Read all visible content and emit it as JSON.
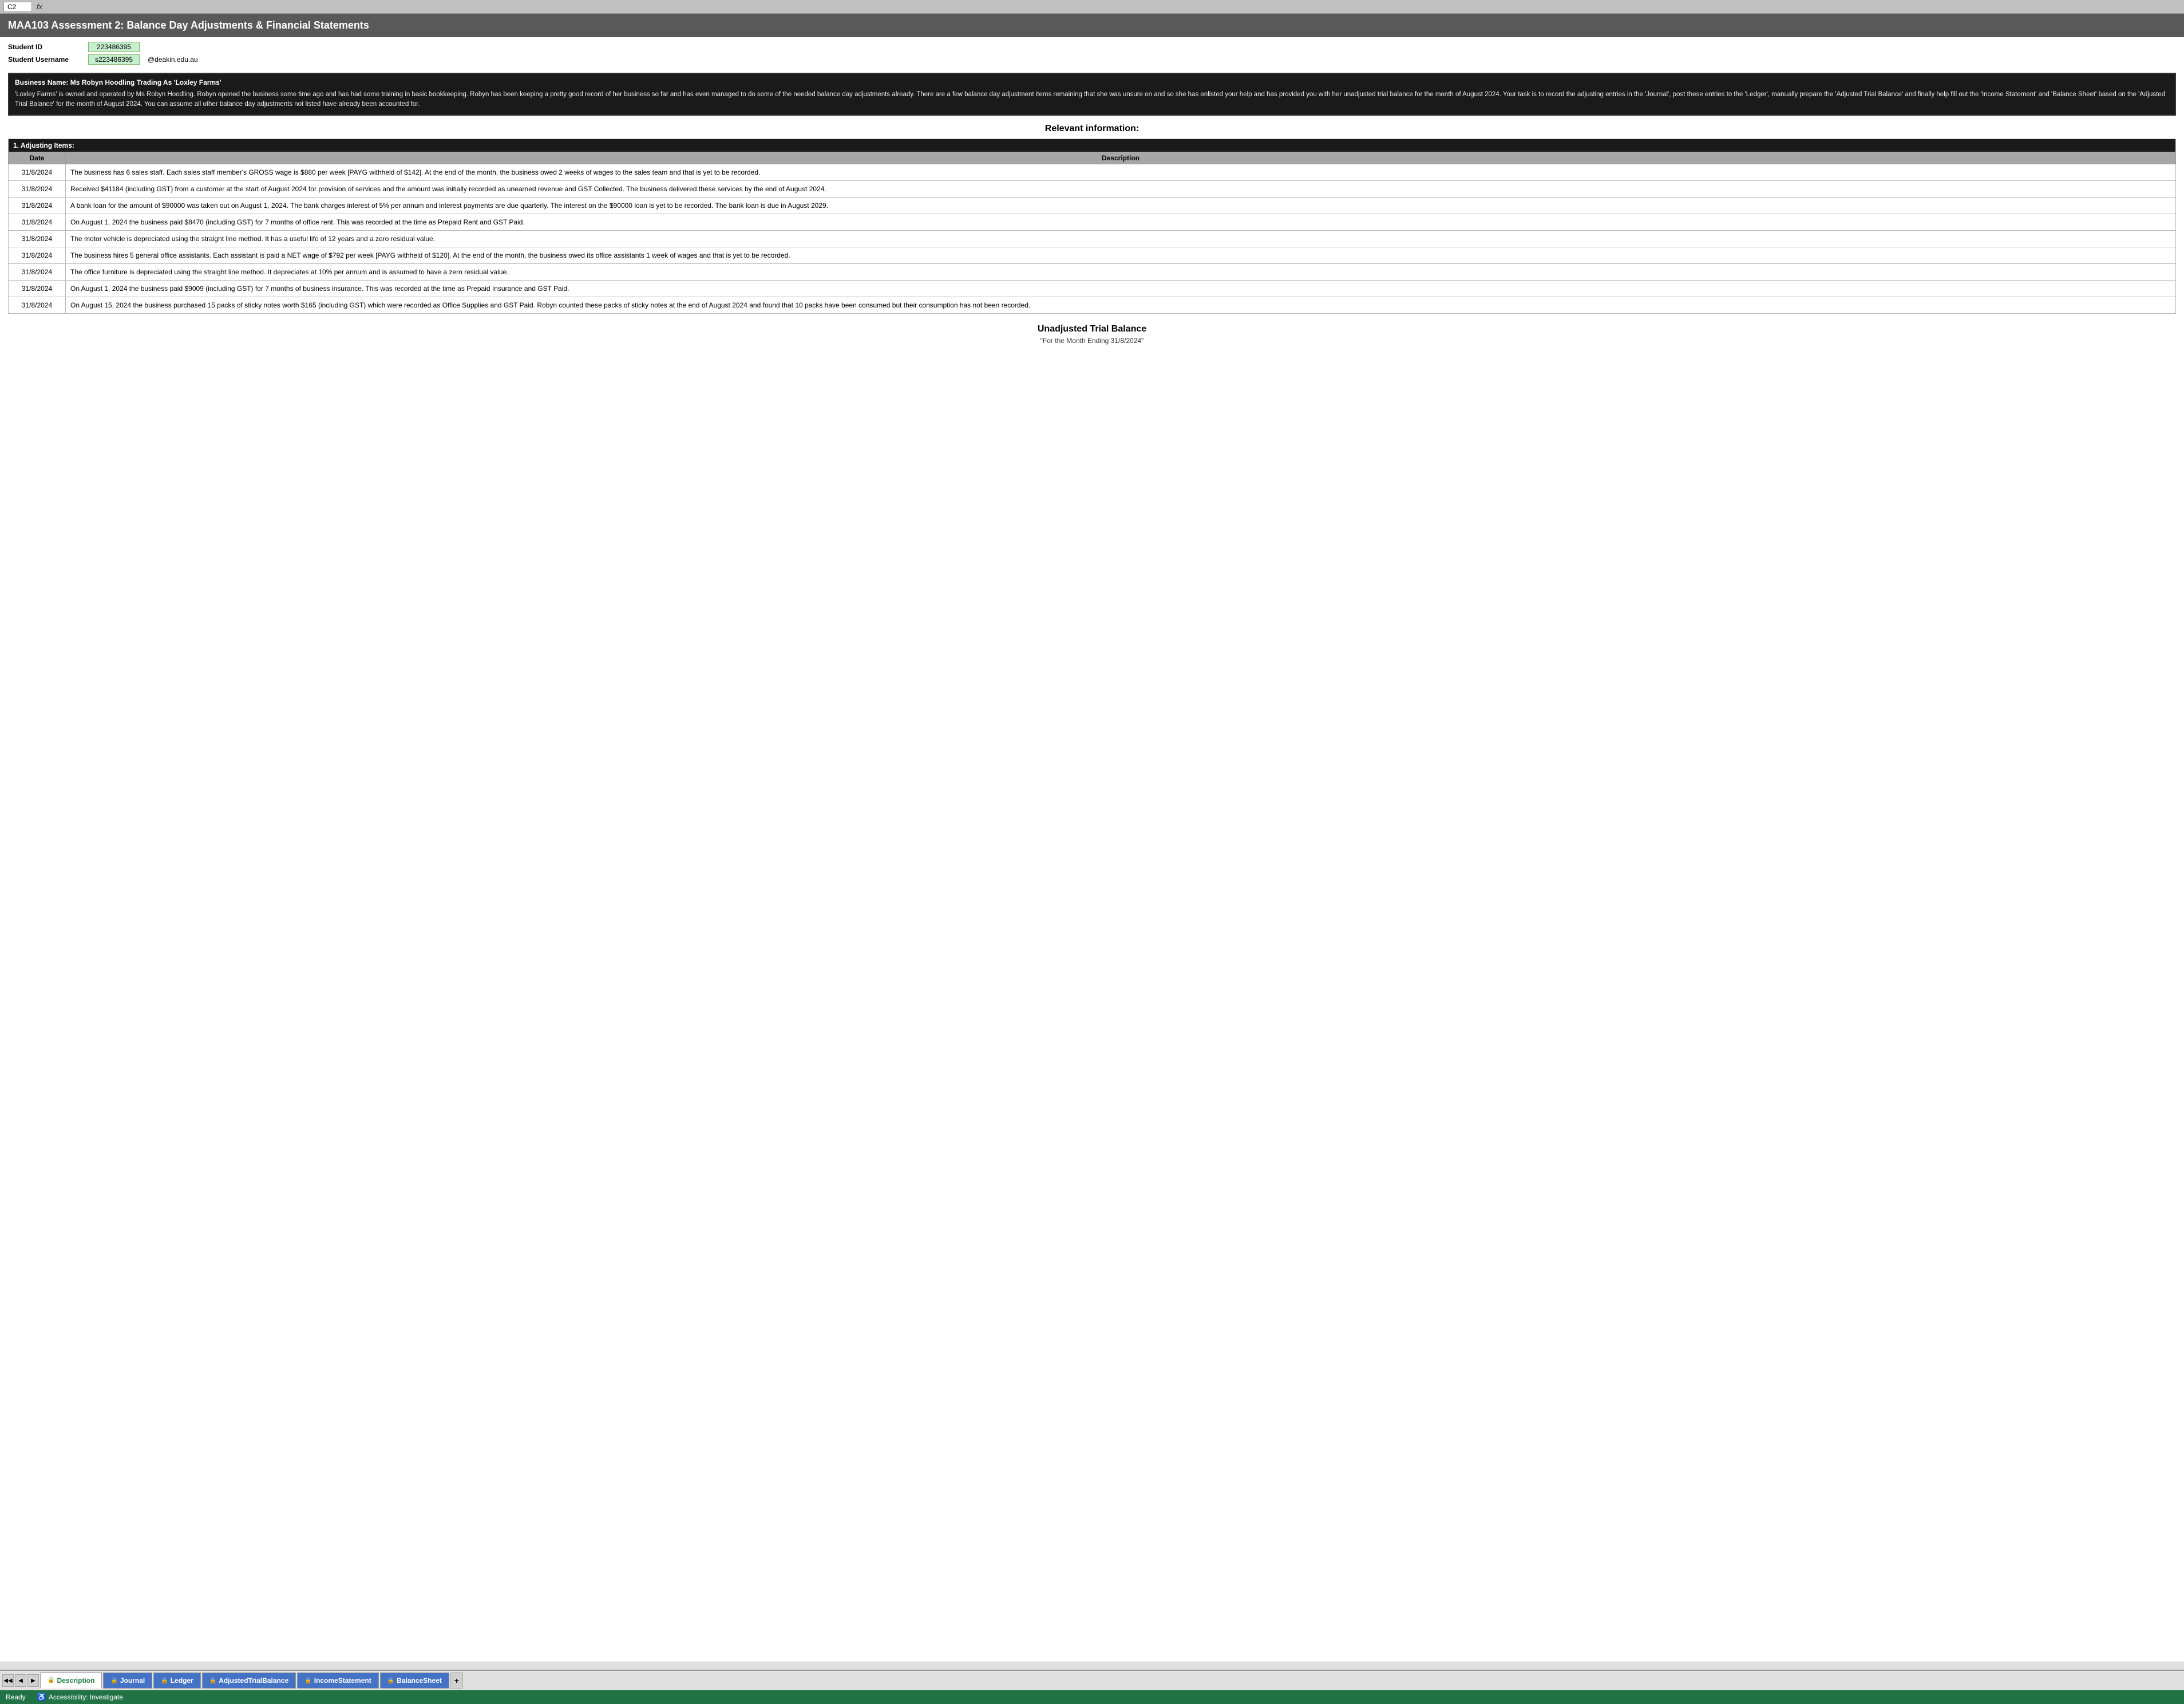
{
  "formula_bar": {
    "cell_ref": "C2",
    "fx": "fx"
  },
  "page_title": "MAA103 Assessment 2: Balance Day Adjustments & Financial Statements",
  "student": {
    "id_label": "Student ID",
    "id_value": "223486395",
    "username_label": "Student Username",
    "username_value": "s223486395",
    "email": "@deakin.edu.au"
  },
  "business": {
    "title": "Business Name: Ms Robyn Hoodling Trading As 'Loxley Farms'",
    "description": "'Loxley Farms' is owned and operated by Ms Robyn Hoodling. Robyn opened the business some time ago and has had some training in basic bookkeeping. Robyn has been keeping a pretty good record of her business so far and has even managed to do some of the needed balance day adjustments already. There are a few balance day adjustment items remaining that she was unsure on and so she has enlisted your help and has provided you with her unadjusted trial balance for the month of August 2024. Your task is to record the adjusting entries in the 'Journal', post these entries to the 'Ledger', manually prepare the 'Adjusted Trial Balance' and finally help fill out the 'Income Statement' and 'Balance Sheet' based on the 'Adjusted Trial Balance' for the month of August 2024. You can assume all other balance day adjustments not listed have already been accounted for."
  },
  "relevant_info_heading": "Relevant information:",
  "adjusting_items": {
    "section_label": "1. Adjusting Items:",
    "col_date": "Date",
    "col_description": "Description",
    "rows": [
      {
        "date": "31/8/2024",
        "description": "The business has 6 sales staff. Each sales staff member's GROSS wage is $880 per week [PAYG withheld of $142]. At the end of the month, the business owed 2 weeks of wages to the sales team and that is yet to be recorded."
      },
      {
        "date": "31/8/2024",
        "description": "Received $41184 (including GST) from a customer at the start of August 2024 for provision of services and the amount was initially recorded as unearned revenue and GST Collected. The business delivered these services by the end of August 2024."
      },
      {
        "date": "31/8/2024",
        "description": "A bank loan for the amount of $90000 was taken out on August 1, 2024. The bank charges interest of 5% per annum and interest payments are due quarterly. The interest on the $90000 loan is yet to be recorded. The bank loan is due in August 2029."
      },
      {
        "date": "31/8/2024",
        "description": "On August 1, 2024 the business paid $8470 (including GST) for 7 months of office rent. This was recorded at the time as Prepaid Rent and GST Paid."
      },
      {
        "date": "31/8/2024",
        "description": "The motor vehicle is depreciated using the straight line method. It has a useful life of 12 years and a zero residual value."
      },
      {
        "date": "31/8/2024",
        "description": "The business hires 5 general office assistants. Each assistant is paid a NET wage of $792 per week [PAYG withheld of $120]. At the end of the month, the business owed its office assistants 1 week of wages and that is yet to be recorded."
      },
      {
        "date": "31/8/2024",
        "description": "The office furniture is depreciated using the straight line method. It depreciates at 10% per annum and is assumed to have a zero residual value."
      },
      {
        "date": "31/8/2024",
        "description": "On August 1, 2024 the business paid $9009 (including GST) for 7 months of business insurance. This was recorded at the time as Prepaid Insurance and GST Paid."
      },
      {
        "date": "31/8/2024",
        "description": "On August 15, 2024 the business purchased 15 packs of sticky notes worth $165 (including GST) which were recorded as Office Supplies and GST Paid. Robyn counted these packs of sticky notes at the end of August 2024 and found that 10 packs have been consumed but their consumption has not been recorded."
      }
    ]
  },
  "utb_heading": "Unadjusted Trial Balance",
  "utb_subheading": "\"For the Month Ending 31/8/2024\"",
  "tabs": [
    {
      "label": "Description",
      "active": true,
      "locked": true
    },
    {
      "label": "Journal",
      "active": false,
      "locked": true
    },
    {
      "label": "Ledger",
      "active": false,
      "locked": true
    },
    {
      "label": "AdjustedTrialBalance",
      "active": false,
      "locked": true
    },
    {
      "label": "IncomeStatement",
      "active": false,
      "locked": true
    },
    {
      "label": "BalanceSheet",
      "active": false,
      "locked": true
    }
  ],
  "status": {
    "ready": "Ready",
    "accessibility": "Accessibility: Investigate"
  }
}
